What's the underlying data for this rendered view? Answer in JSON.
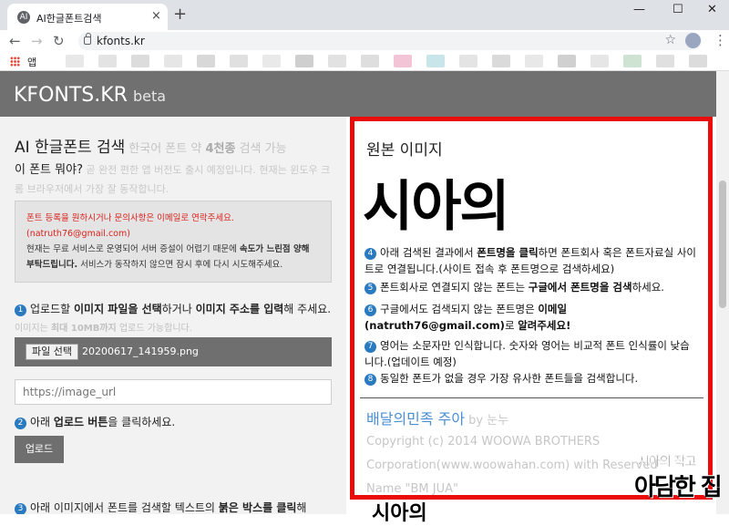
{
  "browser": {
    "tab_title": "AI한글폰트검색",
    "tab_favicon": "AI",
    "new_tab": "+",
    "close_tab": "×",
    "minimize": "—",
    "maximize": "☐",
    "close_window": "✕",
    "back": "←",
    "forward": "→",
    "reload": "↻",
    "url": "kfonts.kr",
    "star": "☆",
    "menu": "⋮",
    "apps_label": "앱",
    "bookmark_colors": [
      "#e8e8e8",
      "#e3e3e3",
      "#dcdcdc",
      "#e6e6e6",
      "#d8d8d8",
      "#e0e0e0",
      "#e9e9e9",
      "#cfcfcf",
      "#e2e2e2",
      "#dedede",
      "#f2c4d6",
      "#c8e6ea",
      "#e4e4e4",
      "#dadada",
      "#e8e8e8",
      "#d0d0d0",
      "#e6e6e6",
      "#cfe3d2",
      "#e0e0e0",
      "#dcdcdc"
    ]
  },
  "header": {
    "brand": "KFONTS.KR",
    "beta": "beta"
  },
  "left": {
    "title": "AI 한글폰트 검색",
    "title_sub_pre": "한국어 폰트 약 ",
    "title_sub_bold": "4천종",
    "title_sub_post": " 검색 가능",
    "question": "이 폰트 뭐야?",
    "question_note": " 곧 완전 편한 앱 버전도 출시 예정입니다. 현재는 윈도우 크롬 브라우저에서 가장 잘 동작합니다.",
    "notice_red": "폰트 등록을 원하시거나 문의사항은 이메일로 연락주세요.",
    "notice_email": "(natruth76@gmail.com)",
    "notice_text_a": "현재는 무료 서비스로 운영되어 서버 증설이 어렵기 때문에 ",
    "notice_bold": "속도가 느린점 양해 부탁드립니다.",
    "notice_text_b": " 서비스가 동작하지 않으면 잠시 후에 다시 시도해주세요.",
    "step1_num": "1",
    "step1_a": "업로드할 ",
    "step1_b": "이미지 파일을 선택",
    "step1_c": "하거나 ",
    "step1_d": "이미지 주소를 입력",
    "step1_e": "해 주세요.",
    "step1_note_a": " 이미지는 ",
    "step1_note_b": "최대 10MB까지",
    "step1_note_c": " 업로드 가능합니다.",
    "file_button": "파일 선택",
    "file_name": "20200617_141959.png",
    "url_placeholder": "https://image_url",
    "step2_num": "2",
    "step2_a": "아래 ",
    "step2_b": "업로드 버튼",
    "step2_c": "을 클릭하세요.",
    "upload_button": "업로드",
    "step3_num": "3",
    "step3_a": "아래 이미지에서 폰트를 검색할 텍스트의 ",
    "step3_b": "붉은 박스를 클릭",
    "step3_c": "해"
  },
  "right": {
    "original_title": "원본 이미지",
    "sample_text": "시아의",
    "s4_num": "4",
    "s4_a": "아래 검색된 결과에서 ",
    "s4_b": "폰트명을 클릭",
    "s4_c": "하면 폰트회사 혹은 폰트자료실 사이트로 연결됩니다.(사이트 접속 후 폰트명으로 검색하세요)",
    "s5_num": "5",
    "s5_a": "폰트회사로 연결되지 않는 폰트는 ",
    "s5_b": "구글에서 폰트명을 검색",
    "s5_c": "하세요.",
    "s6_num": "6",
    "s6_a": "구글에서도 검색되지 않는 폰트명은 ",
    "s6_b": "이메일(natruth76@gmail.com)",
    "s6_c": "로 ",
    "s6_d": "알려주세요!",
    "s7_num": "7",
    "s7_text": "영어는 소문자만 인식합니다. 숫자와 영어는 비교적 폰트 인식률이 낮습니다.(업데이트 예정)",
    "s8_num": "8",
    "s8_text": "동일한 폰트가 없을 경우 가장 유사한 폰트들을 검색합니다.",
    "result_name": "배달의민족 주아",
    "result_by": "by 눈누",
    "copy1": "Copyright (c) 2014 WOOWA BROTHERS",
    "copy2": "Corporation(www.woowahan.com) with Reserved",
    "copy3": "Name \"BM JUA\"",
    "preview_text": "시아의"
  },
  "watermark": {
    "line1": "시아의 작고",
    "line2": "아담한 집"
  },
  "colors": {
    "highlight_border": "#ea0b0b",
    "step_badge": "#2a7ac0",
    "result_link": "#4a8fd6",
    "header_bg": "#707070"
  }
}
